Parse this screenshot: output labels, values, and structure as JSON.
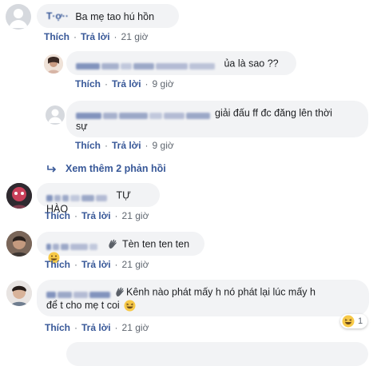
{
  "actions": {
    "like": "Thích",
    "reply": "Trả lời"
  },
  "comments": [
    {
      "author": "T·ợ··",
      "text": "Ba mẹ tao hú hồn",
      "time": "21 giờ"
    },
    {
      "author": "",
      "text": "ủa là sao ??",
      "time": "9 giờ"
    },
    {
      "author": "Thuậ··",
      "text_line1": "giải đấu ff đc đăng lên thời",
      "text_line2": "sự",
      "time": "9 giờ"
    },
    {
      "author": "",
      "text": "TỰ HÀO",
      "time": "21 giờ"
    },
    {
      "author": "",
      "text": "Tèn ten ten ten",
      "time": "21 giờ",
      "icon": "wave-hand-icon"
    },
    {
      "author": "",
      "text_line1": "Kênh nào phát mấy h nó phát lại lúc mấy h",
      "text_line2": "để t cho mẹ t coi",
      "time": "21 giờ",
      "icon": "wave-hand-icon",
      "reaction_count": "1"
    }
  ],
  "view_more": "Xem thêm 2 phản hồi",
  "colors": {
    "link": "#385898",
    "bubble": "#f2f3f5",
    "meta": "#606770"
  }
}
